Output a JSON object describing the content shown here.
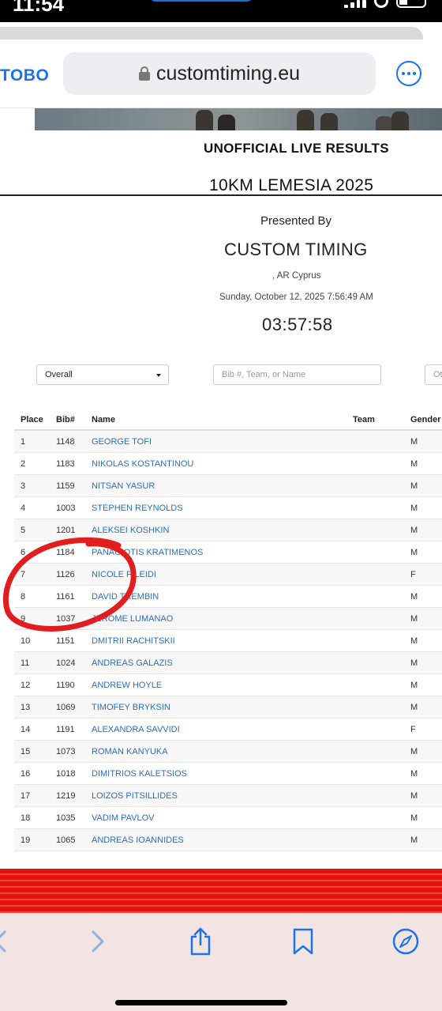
{
  "status_bar": {
    "time": "11:54"
  },
  "browser": {
    "back_label": "TOBO",
    "url": "customtiming.eu",
    "more_icon": "ellipsis-circle-icon"
  },
  "header": {
    "title": "UNOFFICIAL LIVE RESULTS",
    "event": "10KM LEMESIA 2025",
    "presented_by": "Presented By",
    "organizer": "CUSTOM TIMING",
    "location": ", AR Cyprus",
    "datetime": "Sunday, October 12, 2025 7:56:49 AM",
    "elapsed": "03:57:58"
  },
  "filters": {
    "division_selected": "Overall",
    "search_placeholder": "Bib #, Team, or Name",
    "other_placeholder": "Ot"
  },
  "table": {
    "columns": [
      "Place",
      "Bib#",
      "Name",
      "Team",
      "Gender"
    ],
    "rows": [
      [
        "1",
        "1148",
        "GEORGE TOFI",
        "",
        "M"
      ],
      [
        "2",
        "1183",
        "NIKOLAS KOSTANTINOU",
        "",
        "M"
      ],
      [
        "3",
        "1159",
        "NITSAN YASUR",
        "",
        "M"
      ],
      [
        "4",
        "1003",
        "STEPHEN REYNOLDS",
        "",
        "M"
      ],
      [
        "5",
        "1201",
        "ALEKSEI KOSHKIN",
        "",
        "M"
      ],
      [
        "6",
        "1184",
        "PANAGIOTIS KRATIMENOS",
        "",
        "M"
      ],
      [
        "7",
        "1126",
        "NICOLE PILEIDI",
        "",
        "F"
      ],
      [
        "8",
        "1161",
        "DAVID TREMBIN",
        "",
        "M"
      ],
      [
        "9",
        "1037",
        "JEROME LUMANAO",
        "",
        "M"
      ],
      [
        "10",
        "1151",
        "DMITRII RACHITSKII",
        "",
        "M"
      ],
      [
        "11",
        "1024",
        "ANDREAS GALAZIS",
        "",
        "M"
      ],
      [
        "12",
        "1190",
        "ANDREW HOYLE",
        "",
        "M"
      ],
      [
        "13",
        "1069",
        "TIMOFEY BRYKSIN",
        "",
        "M"
      ],
      [
        "14",
        "1191",
        "ALEXANDRA SAVVIDI",
        "",
        "F"
      ],
      [
        "15",
        "1073",
        "ROMAN KANYUKA",
        "",
        "M"
      ],
      [
        "16",
        "1018",
        "DIMITRIOS KALETSIOS",
        "",
        "M"
      ],
      [
        "17",
        "1219",
        "LOIZOS PITSILLIDES",
        "",
        "M"
      ],
      [
        "18",
        "1035",
        "VADIM PAVLOV",
        "",
        "M"
      ],
      [
        "19",
        "1065",
        "ANDREAS IOANNIDES",
        "",
        "M"
      ]
    ]
  },
  "toolbar": {
    "icons": [
      "back-arrow-icon",
      "forward-arrow-icon",
      "share-icon",
      "bookmarks-icon",
      "compass-icon"
    ]
  },
  "colors": {
    "link": "#2a6ebb",
    "accent": "#1a73e8",
    "annotation": "#e21d1d",
    "ad_band": "#e4110f"
  }
}
